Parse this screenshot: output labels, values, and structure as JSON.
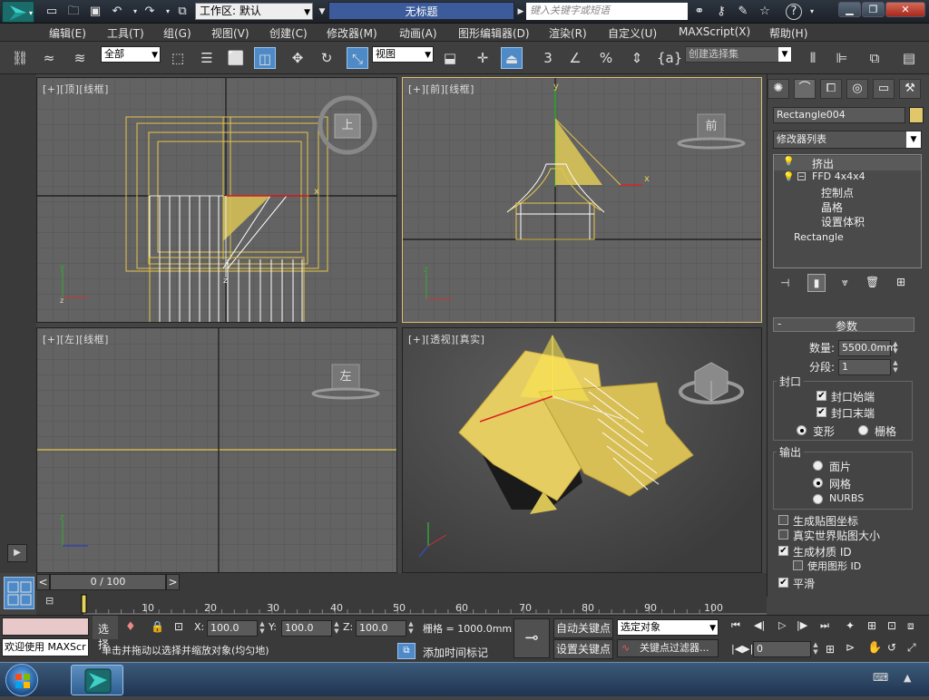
{
  "titlebar": {
    "workspace_label": "工作区: 默认",
    "doc_title": "无标题",
    "search_placeholder": "键入关键字或短语",
    "help_glyph": "?"
  },
  "menu": [
    "编辑(E)",
    "工具(T)",
    "组(G)",
    "视图(V)",
    "创建(C)",
    "修改器(M)",
    "动画(A)",
    "图形编辑器(D)",
    "渲染(R)",
    "自定义(U)",
    "MAXScript(X)",
    "帮助(H)"
  ],
  "toolbar": {
    "selection_filter": "全部",
    "ref_coord": "视图",
    "named_selection": "创建选择集",
    "snap_label": "3",
    "percent_snap": "%"
  },
  "viewports": {
    "top": {
      "label": "[+][顶][线框]",
      "cube": "上"
    },
    "front": {
      "label": "[+][前][线框]",
      "cube": "前"
    },
    "left": {
      "label": "[+][左][线框]",
      "cube": "左"
    },
    "persp": {
      "label": "[+][透视][真实]"
    }
  },
  "command_panel": {
    "object_name": "Rectangle004",
    "object_color": "#e1c76b",
    "modifier_list": "修改器列表",
    "stack": [
      {
        "label": "挤出",
        "level": 0
      },
      {
        "label": "FFD 4x4x4",
        "level": 0
      },
      {
        "label": "控制点",
        "level": 1
      },
      {
        "label": "晶格",
        "level": 1
      },
      {
        "label": "设置体积",
        "level": 1
      },
      {
        "label": "Rectangle",
        "level": 0
      }
    ],
    "params_title": "参数",
    "amount_label": "数量:",
    "amount_value": "5500.0mm",
    "segments_label": "分段:",
    "segments_value": "1",
    "capping_title": "封口",
    "cap_start": "封口始端",
    "cap_end": "封口末端",
    "morph": "变形",
    "grid": "栅格",
    "output_title": "输出",
    "patch": "面片",
    "mesh": "网格",
    "nurbs": "NURBS",
    "gen_map": "生成贴图坐标",
    "real_world": "真实世界贴图大小",
    "gen_mat": "生成材质 ID",
    "use_shape_id": "使用图形 ID",
    "smooth": "平滑"
  },
  "timeline": {
    "frame_display": "0 / 100",
    "ticks": [
      "10",
      "20",
      "30",
      "40",
      "50",
      "60",
      "70",
      "80",
      "90",
      "100"
    ]
  },
  "status": {
    "welcome": "欢迎使用 MAXScr",
    "select_label": "选择",
    "x_label": "X:",
    "x_value": "100.0",
    "y_label": "Y:",
    "y_value": "100.0",
    "z_label": "Z:",
    "z_value": "100.0",
    "grid_text": "栅格 = 1000.0mm",
    "auto_key": "自动关键点",
    "set_key": "设置关键点",
    "selected_object": "选定对象",
    "key_filters": "关键点过滤器...",
    "prompt": "单击并拖动以选择并缩放对象(均匀地)",
    "add_time_tag": "添加时间标记",
    "frame_value": "0"
  }
}
